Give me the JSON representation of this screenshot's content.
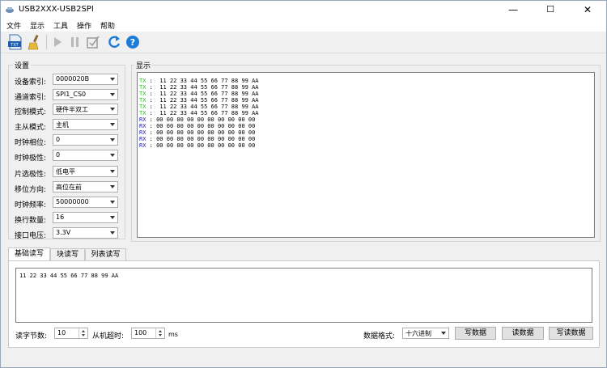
{
  "window": {
    "title": "USB2XXX-USB2SPI",
    "minimize": "—",
    "maximize": "☐",
    "close": "✕"
  },
  "menu": [
    "文件",
    "显示",
    "工具",
    "操作",
    "帮助"
  ],
  "toolbar": {
    "save_text_label": "TXT",
    "icons": [
      "save-txt-icon",
      "clear-brush-icon",
      "play-icon",
      "pause-icon",
      "edit-checkbox-icon",
      "refresh-icon",
      "help-icon"
    ]
  },
  "settings": {
    "group_title": "设置",
    "rows": [
      {
        "label": "设备索引:",
        "value": "0000020B"
      },
      {
        "label": "通道索引:",
        "value": "SPI1_CS0"
      },
      {
        "label": "控制模式:",
        "value": "硬件半双工"
      },
      {
        "label": "主从模式:",
        "value": "主机"
      },
      {
        "label": "时钟相位:",
        "value": "0"
      },
      {
        "label": "时钟极性:",
        "value": "0"
      },
      {
        "label": "片选极性:",
        "value": "低电平"
      },
      {
        "label": "移位方向:",
        "value": "高位在前"
      },
      {
        "label": "时钟频率:",
        "value": "50000000"
      },
      {
        "label": "换行数量:",
        "value": "16"
      },
      {
        "label": "接口电压:",
        "value": "3.3V"
      }
    ]
  },
  "display": {
    "group_title": "显示",
    "lines": [
      {
        "dir": "TX",
        "data": " :  11 22 33 44 55 66 77 88 99 AA"
      },
      {
        "dir": "TX",
        "data": " :  11 22 33 44 55 66 77 88 99 AA"
      },
      {
        "dir": "TX",
        "data": " :  11 22 33 44 55 66 77 88 99 AA"
      },
      {
        "dir": "TX",
        "data": " :  11 22 33 44 55 66 77 88 99 AA"
      },
      {
        "dir": "TX",
        "data": " :  11 22 33 44 55 66 77 88 99 AA"
      },
      {
        "dir": "TX",
        "data": " :  11 22 33 44 55 66 77 88 99 AA"
      },
      {
        "dir": "RX",
        "data": " : 00 00 00 00 00 00 00 00 00 00"
      },
      {
        "dir": "RX",
        "data": " : 00 00 00 00 00 00 00 00 00 00"
      },
      {
        "dir": "RX",
        "data": " : 00 00 00 00 00 00 00 00 00 00"
      },
      {
        "dir": "RX",
        "data": " : 00 00 00 00 00 00 00 00 00 00"
      },
      {
        "dir": "RX",
        "data": " : 00 00 00 00 00 00 00 00 00 00"
      }
    ]
  },
  "tabs": [
    "基础读写",
    "块读写",
    "列表读写"
  ],
  "basic": {
    "write_data": "11 22 33 44 55 66 77 88 99 AA",
    "read_bytes_label": "读字节数:",
    "read_bytes_value": "10",
    "slave_timeout_label": "从机超时:",
    "slave_timeout_value": "100",
    "timeout_unit": "ms",
    "data_format_label": "数据格式:",
    "data_format_value": "十六进制",
    "write_button": "写数据",
    "read_button": "读数据",
    "write_read_button": "写读数据"
  },
  "colors": {
    "tx": "#19c519",
    "rx": "#1a1ad8"
  }
}
